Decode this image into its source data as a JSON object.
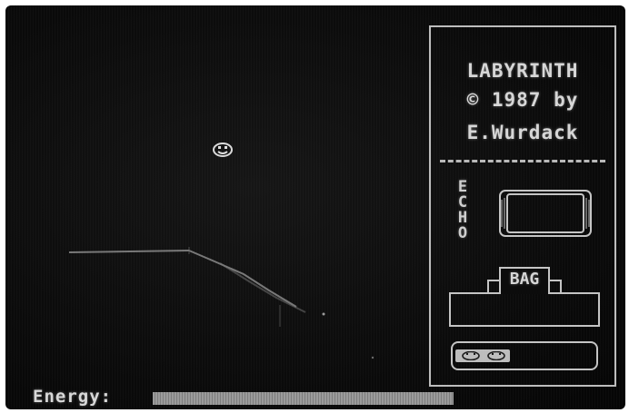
{
  "window": {
    "title_line_1": "LABYRINTH",
    "title_line_2": "© 1987 by",
    "title_line_3": "E.Wurdack"
  },
  "panel": {
    "echo_label": "ECHO",
    "bag_label": "BAG",
    "lives": 2
  },
  "status": {
    "energy_label": "Energy:",
    "energy_level": 0.98
  },
  "colors": {
    "screen": "#0c0c0c",
    "phosphor": "#d6d6d6",
    "frame": "#c4c4c4"
  },
  "icons": {
    "player": "smiley-face-icon",
    "life": "smiley-face-icon"
  }
}
